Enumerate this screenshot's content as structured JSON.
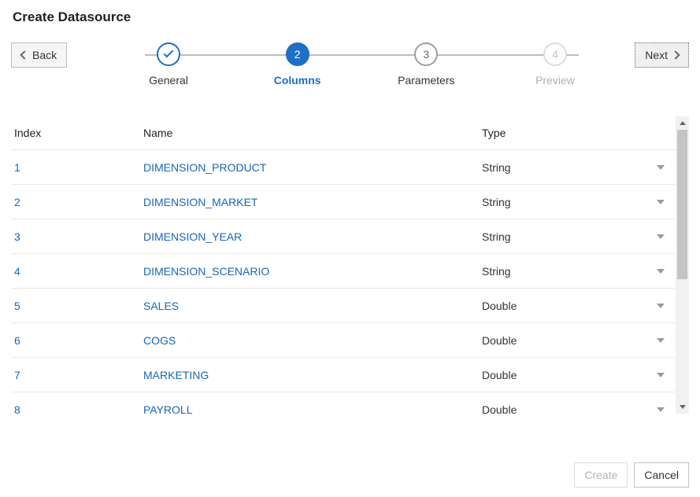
{
  "title": "Create Datasource",
  "buttons": {
    "back": "Back",
    "next": "Next",
    "create": "Create",
    "cancel": "Cancel"
  },
  "steps": [
    {
      "num": "",
      "label": "General",
      "state": "done"
    },
    {
      "num": "2",
      "label": "Columns",
      "state": "active"
    },
    {
      "num": "3",
      "label": "Parameters",
      "state": "pending"
    },
    {
      "num": "4",
      "label": "Preview",
      "state": "disabled"
    }
  ],
  "columns": {
    "headers": {
      "index": "Index",
      "name": "Name",
      "type": "Type"
    },
    "rows": [
      {
        "index": "1",
        "name": "DIMENSION_PRODUCT",
        "type": "String"
      },
      {
        "index": "2",
        "name": "DIMENSION_MARKET",
        "type": "String"
      },
      {
        "index": "3",
        "name": "DIMENSION_YEAR",
        "type": "String"
      },
      {
        "index": "4",
        "name": "DIMENSION_SCENARIO",
        "type": "String"
      },
      {
        "index": "5",
        "name": "SALES",
        "type": "Double"
      },
      {
        "index": "6",
        "name": "COGS",
        "type": "Double"
      },
      {
        "index": "7",
        "name": "MARKETING",
        "type": "Double"
      },
      {
        "index": "8",
        "name": "PAYROLL",
        "type": "Double"
      }
    ]
  }
}
